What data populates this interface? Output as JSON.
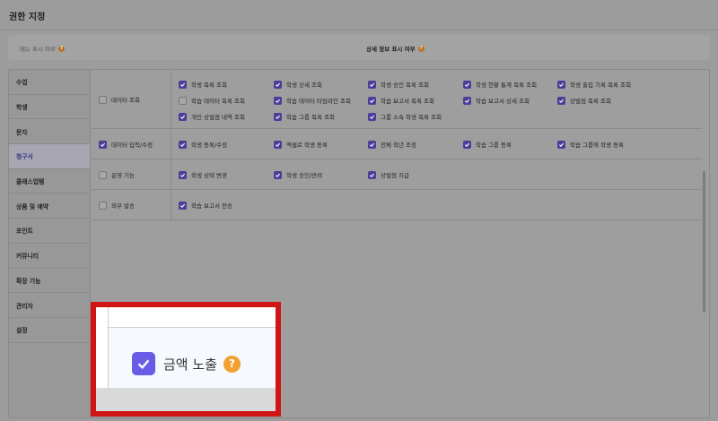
{
  "page_title": "권한 지정",
  "toggles": {
    "menu_display": "메뉴 표시 여부",
    "detail_display": "상세 정보 표시 여부",
    "help_glyph": "?"
  },
  "nav": {
    "items": [
      {
        "label": "수업"
      },
      {
        "label": "학생"
      },
      {
        "label": "문자"
      },
      {
        "label": "청구서"
      },
      {
        "label": "클래스업템"
      },
      {
        "label": "상품 및 예약"
      },
      {
        "label": "포인트"
      },
      {
        "label": "커뮤니티"
      },
      {
        "label": "확장 기능"
      },
      {
        "label": "관리자"
      },
      {
        "label": "설정"
      }
    ],
    "active": "청구서"
  },
  "permissions": [
    {
      "category": "데이터 조회",
      "category_checked": false,
      "options": [
        {
          "label": "학생 목록 조회",
          "checked": true
        },
        {
          "label": "학생 상세 조회",
          "checked": true
        },
        {
          "label": "학생 승인 목록 조회",
          "checked": true
        },
        {
          "label": "학생 현황 통계 목록 조회",
          "checked": true
        },
        {
          "label": "학생 출입 기록 목록 조회",
          "checked": true
        },
        {
          "label": "학습 데이터 목록 조회",
          "checked": false
        },
        {
          "label": "학습 데이터 타임라인 조회",
          "checked": true
        },
        {
          "label": "학습 보고서 목록 조회",
          "checked": true
        },
        {
          "label": "학습 보고서 상세 조회",
          "checked": true
        },
        {
          "label": "상벌점 목록 조회",
          "checked": true
        },
        {
          "label": "개인 상벌점 내역 조회",
          "checked": true
        },
        {
          "label": "학습 그룹 목록 조회",
          "checked": true
        },
        {
          "label": "그룹 소속 학생 목록 조회",
          "checked": true
        }
      ]
    },
    {
      "category": "데이터 입력/수정",
      "category_checked": true,
      "options": [
        {
          "label": "학생 등록/수정",
          "checked": true
        },
        {
          "label": "엑셀로 학생 등록",
          "checked": true
        },
        {
          "label": "전체 학년 조정",
          "checked": true
        },
        {
          "label": "학습 그룹 등록",
          "checked": true
        },
        {
          "label": "학습 그룹에 학생 등록",
          "checked": true
        }
      ]
    },
    {
      "category": "운영 기능",
      "category_checked": false,
      "options": [
        {
          "label": "학생 상태 변경",
          "checked": true
        },
        {
          "label": "학생 승인/반려",
          "checked": true
        },
        {
          "label": "상벌점 지급",
          "checked": true
        }
      ]
    },
    {
      "category": "외부 발송",
      "category_checked": false,
      "options": [
        {
          "label": "학습 보고서 전송",
          "checked": true
        }
      ]
    }
  ],
  "highlight": {
    "label": "금액 노출",
    "checked": true,
    "help_glyph": "?",
    "accent": "#6b5ce7",
    "help_color": "#f0a030",
    "border_color": "#d01515"
  }
}
